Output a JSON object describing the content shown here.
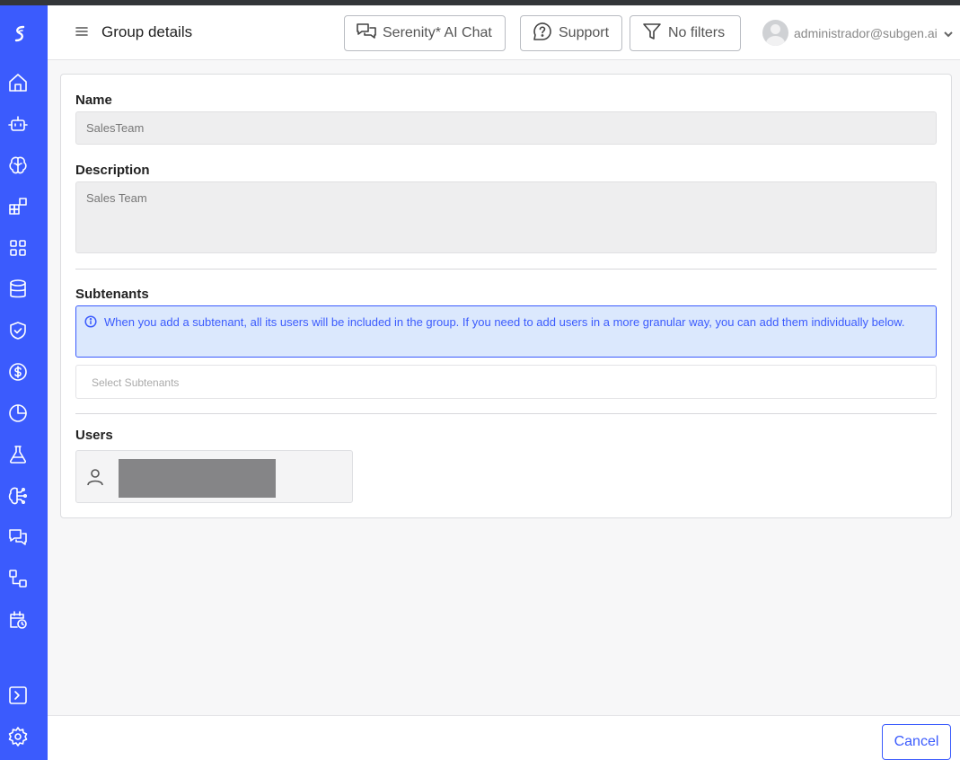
{
  "header": {
    "title": "Group details",
    "chat_button": "Serenity* AI Chat",
    "support_button": "Support",
    "filters_button": "No filters",
    "user_email": "administrador@subgen.ai"
  },
  "sidebar": {
    "accent_color": "#3b5bfd",
    "icons": [
      "logo-icon",
      "home-icon",
      "bot-icon",
      "brain-icon",
      "widgets-icon",
      "grid-icon",
      "database-icon",
      "shield-check-icon",
      "dollar-icon",
      "pie-chart-icon",
      "flask-icon",
      "brain-circuit-icon",
      "chat-icon",
      "workflow-icon",
      "calendar-clock-icon",
      "terminal-icon",
      "gear-icon"
    ]
  },
  "form": {
    "name_label": "Name",
    "name_value": "SalesTeam",
    "description_label": "Description",
    "description_value": "Sales Team",
    "subtenants_label": "Subtenants",
    "subtenants_info": "When you add a subtenant, all its users will be included in the group. If you need to add users in a more granular way, you can add them individually below.",
    "subtenants_placeholder": "Select Subtenants",
    "users_label": "Users"
  },
  "footer": {
    "cancel_label": "Cancel"
  }
}
